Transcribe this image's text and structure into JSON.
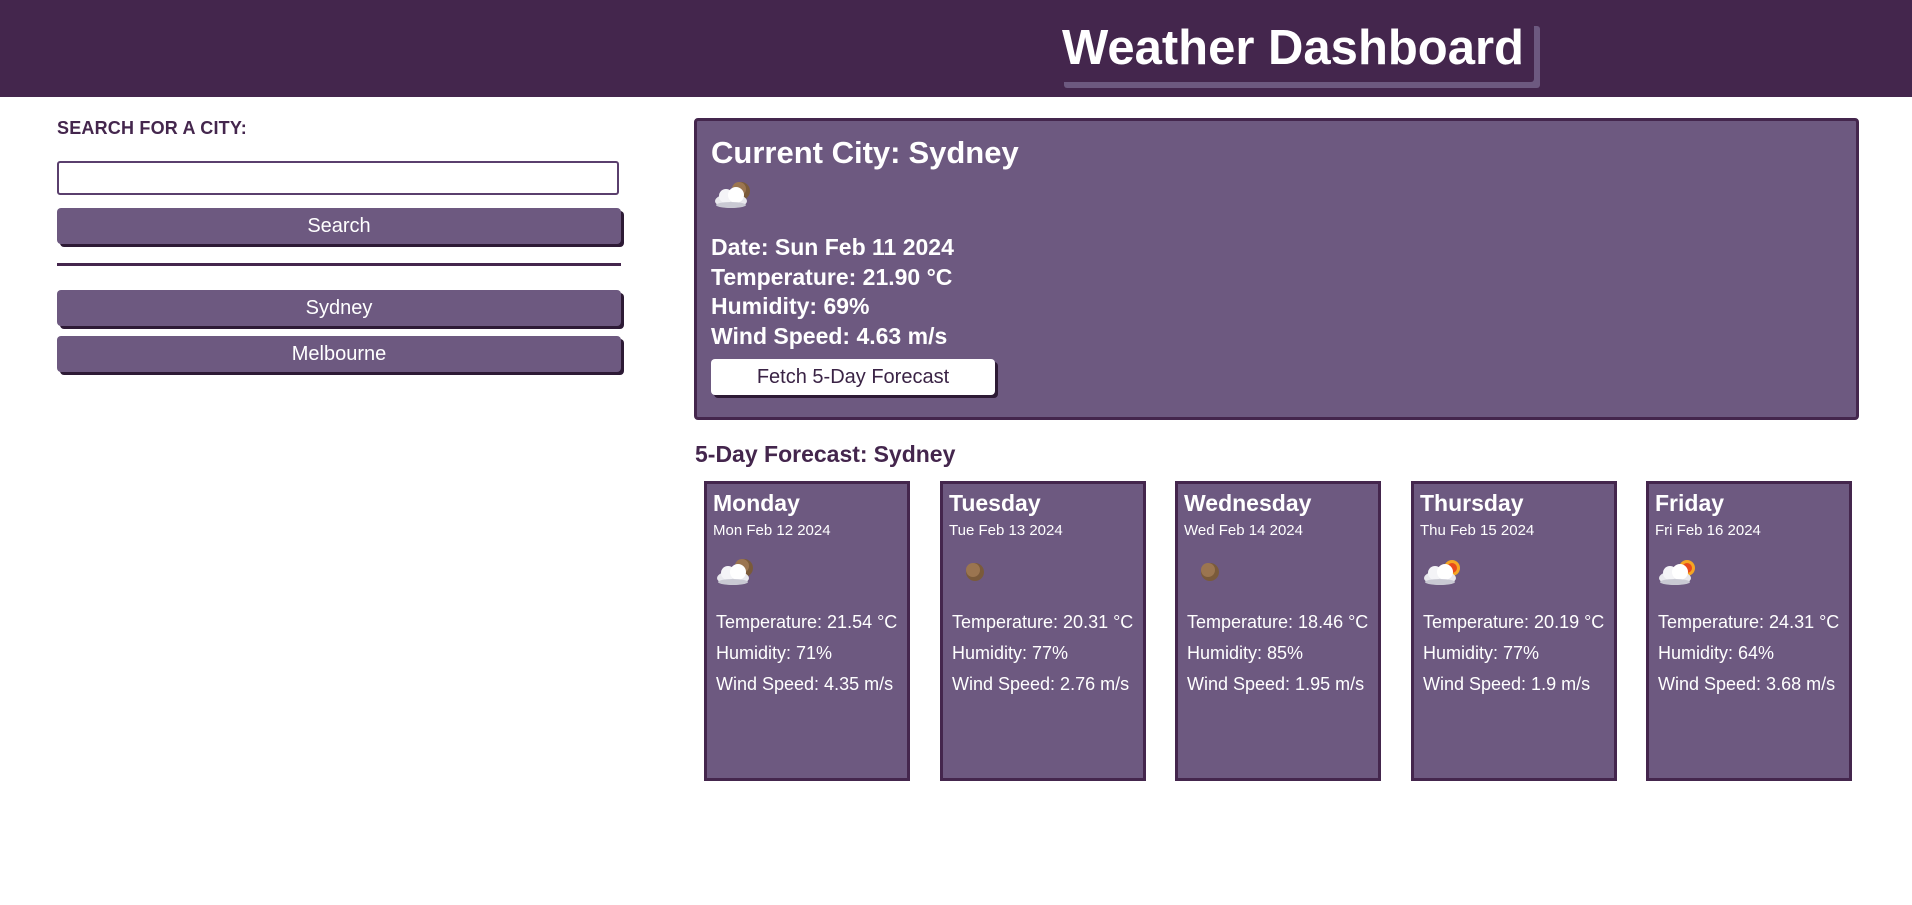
{
  "header": {
    "title": "Weather Dashboard"
  },
  "sidebar": {
    "search_label": "SEARCH FOR A CITY:",
    "search_input_value": "",
    "search_button": "Search",
    "history": [
      "Sydney",
      "Melbourne"
    ]
  },
  "current": {
    "title_prefix": "Current City:",
    "city": "Sydney",
    "icon": "cloud-with-moon-icon",
    "date": "Date: Sun Feb 11 2024",
    "temperature": "Temperature: 21.90 °C",
    "humidity": "Humidity: 69%",
    "wind": "Wind Speed: 4.63 m/s",
    "fetch_button": "Fetch 5-Day Forecast"
  },
  "forecast": {
    "heading_prefix": "5-Day Forecast:",
    "city": "Sydney",
    "days": [
      {
        "day": "Monday",
        "date": "Mon Feb 12 2024",
        "icon": "cloud-with-moon-icon",
        "temperature": "Temperature: 21.54 °C",
        "humidity": "Humidity: 71%",
        "wind": "Wind Speed: 4.35 m/s"
      },
      {
        "day": "Tuesday",
        "date": "Tue Feb 13 2024",
        "icon": "moon-icon",
        "temperature": "Temperature: 20.31 °C",
        "humidity": "Humidity: 77%",
        "wind": "Wind Speed: 2.76 m/s"
      },
      {
        "day": "Wednesday",
        "date": "Wed Feb 14 2024",
        "icon": "moon-icon",
        "temperature": "Temperature: 18.46 °C",
        "humidity": "Humidity: 85%",
        "wind": "Wind Speed: 1.95 m/s"
      },
      {
        "day": "Thursday",
        "date": "Thu Feb 15 2024",
        "icon": "cloud-with-sun-icon",
        "temperature": "Temperature: 20.19 °C",
        "humidity": "Humidity: 77%",
        "wind": "Wind Speed: 1.9 m/s"
      },
      {
        "day": "Friday",
        "date": "Fri Feb 16 2024",
        "icon": "cloud-with-sun-icon",
        "temperature": "Temperature: 24.31 °C",
        "humidity": "Humidity: 64%",
        "wind": "Wind Speed: 3.68 m/s"
      }
    ]
  },
  "colors": {
    "header": "#44264d",
    "panel": "#6d5980",
    "accent": "#6d5980"
  }
}
